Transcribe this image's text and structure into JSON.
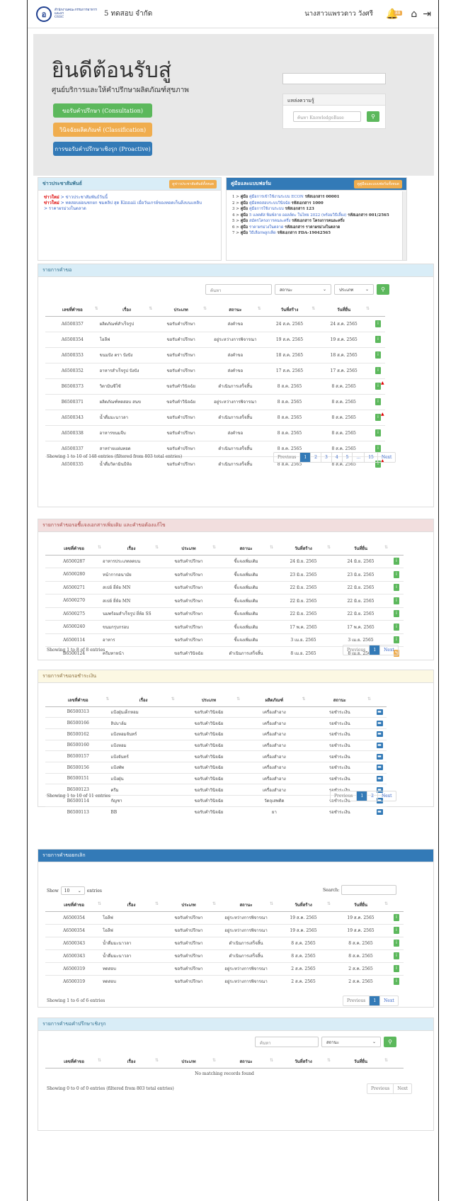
{
  "header": {
    "logo_text": "สำนักงานคณะกรรมการอาหารและยา",
    "logo_sub": "OSSC",
    "company": "5 ทดสอบ จำกัด",
    "username": "นางสาวแพรวดาว วังศรี",
    "notif_badge": "88"
  },
  "hero": {
    "title": "ยินดีต้อนรับสู่",
    "subtitle": "ศูนย์บริการและให้คำปรึกษาผลิตภัณฑ์สุขภาพ",
    "btn_consult": "ขอรับคำปรึกษา (Consultation)",
    "btn_classify": "วินิจฉัยผลิตภัณฑ์ (Classification)",
    "btn_proactive": "การขอรับคำปรึกษาเชิงรุก (Proactive)",
    "knowledge_title": "แหล่งความรู้",
    "knowledge_placeholder": "ค้นหา KnowledgeBase"
  },
  "news": {
    "title": "ข่าวประชาสัมพันธ์",
    "btn": "ดูข่าวประชาสัมพันธ์ทั้งหมด",
    "items": [
      {
        "tag": "ข่าวใหม่",
        "text": "> ข่าวประชาสัมพันธ์วันนี้"
      },
      {
        "tag": "ข่าวใหม่",
        "text": "> ทดสอบผ่อนชกยก ชมคลิป สุด Kinnaii เมื่อวันเกรย์ของทอดเก็นลีงบนแหลิบ"
      },
      {
        "tag": "",
        "text": "> ราคาผรม่วงในตลาด"
      }
    ]
  },
  "manual": {
    "title": "คู่มือและแบบฟอร์ม",
    "btn": "ดูคู่มือและแบบฟอร์มทั้งหมด",
    "items": [
      {
        "n": "1 >",
        "k": "คู่มือ",
        "t": "คู่มือการเข้าใช้งานระบบ ECON",
        "r": "รหัสเอกสาร 00001"
      },
      {
        "n": "2 >",
        "k": "คู่มือ",
        "t": "คู่มือทดสอบระบบวินิจฉัย",
        "r": "รหัสเอกสาร 1000"
      },
      {
        "n": "3 >",
        "k": "คู่มือ",
        "t": "คู่มือการใช้งานระบบ",
        "r": "รหัสเอกสาร 123"
      },
      {
        "n": "4 >",
        "k": "คู่มือ",
        "t": "5 แลคตัส พิมพ์ลาย ออลล์ตะ ในไทย 2022 (พร้อมวิธีเลี้ยง)",
        "r": "รหัสเอกสาร 001/2565"
      },
      {
        "n": "5 >",
        "k": "คู่มือ",
        "t": "สมัครโครงการคนละครึ่ง",
        "r": "รหัสเอกสาร โครงการคนละครึ่ง"
      },
      {
        "n": "6 >",
        "k": "คู่มือ",
        "t": "ราคาผรม่วงในตลาด",
        "r": "รหัสเอกสาร ราคาผรม่วงในตลาด"
      },
      {
        "n": "7 >",
        "k": "คู่มือ",
        "t": "วิธีเลือกพลูกเห็ด",
        "r": "รหัสเอกสาร FDA-19042565"
      }
    ]
  },
  "requests": {
    "title": "รายการคำขอ",
    "search_placeholder": "ค้นหา",
    "status_label": "สถานะ",
    "type_label": "ประเภท",
    "columns": [
      "เลขที่คำขอ",
      "เรื่อง",
      "ประเภท",
      "สถานะ",
      "วันที่สร้าง",
      "วันที่ยื่น"
    ],
    "rows": [
      [
        "A6500357",
        "ผลิตภัณฑ์สำเร็จรูป",
        "ขอรับคำปรึกษา",
        "ส่งคำขอ",
        "24 ส.ค. 2565",
        "24 ส.ค. 2565"
      ],
      [
        "A6500354",
        "โอลีฟ",
        "ขอรับคำปรึกษา",
        "อยู่ระหว่างการพิจารณา",
        "19 ส.ค. 2565",
        "19 ส.ค. 2565"
      ],
      [
        "A6500353",
        "ขนมปัง ตรา ปังปัง",
        "ขอรับคำปรึกษา",
        "ส่งคำขอ",
        "18 ส.ค. 2565",
        "18 ส.ค. 2565"
      ],
      [
        "A6500352",
        "อาหารสำเร็จรูป ปังปัง",
        "ขอรับคำปรึกษา",
        "ส่งคำขอ",
        "17 ส.ค. 2565",
        "17 ส.ค. 2565"
      ],
      [
        "B6500373",
        "วิตามินซีโซ้",
        "ขอรับคำวินิจฉัย",
        "ดำเนินการเสร็จสิ้น",
        "8 ส.ค. 2565",
        "8 ส.ค. 2565"
      ],
      [
        "B6500371",
        "ผลิตภัณฑ์ทดสอบ สนข",
        "ขอรับคำวินิจฉัย",
        "อยู่ระหว่างการพิจารณา",
        "8 ส.ค. 2565",
        "8 ส.ค. 2565"
      ],
      [
        "A6500343",
        "น้ำดื่มมะนาวลา",
        "ขอรับคำปรึกษา",
        "ดำเนินการเสร็จสิ้น",
        "8 ส.ค. 2565",
        "8 ส.ค. 2565"
      ],
      [
        "A6500338",
        "อาหารขนมจีบ",
        "ขอรับคำปรึกษา",
        "ส่งคำขอ",
        "8 ส.ค. 2565",
        "8 ส.ค. 2565"
      ],
      [
        "A6500337",
        "สาหร่ายแผ่นทอด",
        "ขอรับคำปรึกษา",
        "ดำเนินการเสร็จสิ้น",
        "8 ส.ค. 2565",
        "8 ส.ค. 2565"
      ],
      [
        "A6500335",
        "น้ำดื่มวิตามินบีห้อ",
        "ขอรับคำปรึกษา",
        "ดำเนินการเสร็จสิ้น",
        "8 ส.ค. 2565",
        "8 ส.ค. 2565"
      ]
    ],
    "info": "Showing 1 to 10 of 148 entries (filtered from 803 total entries)",
    "pages": [
      "Previous",
      "1",
      "2",
      "3",
      "4",
      "5",
      "...",
      "15",
      "Next"
    ]
  },
  "pending_docs": {
    "title": "รายการคำขอรอชี้แจงเอกสารเพิ่มเติม และคำขอต้องแก้ไข",
    "columns": [
      "เลขที่คำขอ",
      "เรื่อง",
      "ประเภท",
      "สถานะ",
      "วันที่สร้าง",
      "วันที่ยื่น"
    ],
    "rows": [
      [
        "A6500287",
        "อาหารประเภทลดบน",
        "ขอรับคำปรึกษา",
        "ชี้แจงเพิ่มเติม",
        "24 มิ.ย. 2565",
        "24 มิ.ย. 2565"
      ],
      [
        "A6500280",
        "หน้ากากอนามัย",
        "ขอรับคำปรึกษา",
        "ชี้แจงเพิ่มเติม",
        "23 มิ.ย. 2565",
        "23 มิ.ย. 2565"
      ],
      [
        "A6500271",
        "สเปย์ ยี่ห้อ MN",
        "ขอรับคำปรึกษา",
        "ชี้แจงเพิ่มเติม",
        "22 มิ.ย. 2565",
        "22 มิ.ย. 2565"
      ],
      [
        "A6500270",
        "สเปย์ ยี่ห้อ MN",
        "ขอรับคำปรึกษา",
        "ชี้แจงเพิ่มเติม",
        "22 มิ.ย. 2565",
        "22 มิ.ย. 2565"
      ],
      [
        "A6500275",
        "นมพร้อมสำเร็จรูป ยี่ห้อ SS",
        "ขอรับคำปรึกษา",
        "ชี้แจงเพิ่มเติม",
        "22 มิ.ย. 2565",
        "22 มิ.ย. 2565"
      ],
      [
        "A6500240",
        "ขนมกรุบกรอบ",
        "ขอรับคำปรึกษา",
        "ชี้แจงเพิ่มเติม",
        "17 พ.ค. 2565",
        "17 พ.ค. 2565"
      ],
      [
        "A6500114",
        "อาหาร",
        "ขอรับคำปรึกษา",
        "ชี้แจงเพิ่มเติม",
        "3 เม.ย. 2565",
        "3 เม.ย. 2565"
      ],
      [
        "B6500124",
        "ครีมทาหน้า",
        "ขอรับคำวินิจฉัย",
        "ดำเนินการเสร็จสิ้น",
        "8 เม.ย. 2565",
        "8 เม.ย. 2565"
      ]
    ],
    "info": "Showing 1 to 8 of 8 entries",
    "pages": [
      "Previous",
      "1",
      "Next"
    ]
  },
  "payment": {
    "title": "รายการคำขอรอชำระเงิน",
    "columns": [
      "เลขที่คำขอ",
      "เรื่อง",
      "ประเภท",
      "ผลิตภัณฑ์",
      "สถานะ"
    ],
    "rows": [
      [
        "B6500313",
        "แป้งฝุ่นเด็กหอม",
        "ขอรับคำวินิจฉัย",
        "เครื่องสำอาง",
        "รอชำระเงิน"
      ],
      [
        "B6500166",
        "ลิปบาล์ม",
        "ขอรับคำวินิจฉัย",
        "เครื่องสำอาง",
        "รอชำระเงิน"
      ],
      [
        "B6500162",
        "แป้งหอมจันทร์",
        "ขอรับคำวินิจฉัย",
        "เครื่องสำอาง",
        "รอชำระเงิน"
      ],
      [
        "B6500160",
        "แป้งหอม",
        "ขอรับคำวินิจฉัย",
        "เครื่องสำอาง",
        "รอชำระเงิน"
      ],
      [
        "B6500157",
        "แป้งจันทร์",
        "ขอรับคำวินิจฉัย",
        "เครื่องสำอาง",
        "รอชำระเงิน"
      ],
      [
        "B6500156",
        "แป้งพัพ",
        "ขอรับคำวินิจฉัย",
        "เครื่องสำอาง",
        "รอชำระเงิน"
      ],
      [
        "B6500151",
        "แป้งฝุ่น",
        "ขอรับคำวินิจฉัย",
        "เครื่องสำอาง",
        "รอชำระเงิน"
      ],
      [
        "B6500123",
        "ครีม",
        "ขอรับคำวินิจฉัย",
        "เครื่องสำอาง",
        "รอชำระเงิน"
      ],
      [
        "B6500114",
        "กัญชา",
        "ขอรับคำวินิจฉัย",
        "วัตถุเสพติด",
        "รอชำระเงิน"
      ],
      [
        "B6500113",
        "BB",
        "ขอรับคำวินิจฉัย",
        "ยา",
        "รอชำระเงิน"
      ]
    ],
    "info": "Showing 1 to 10 of 11 entries",
    "pages": [
      "Previous",
      "1",
      "2",
      "Next"
    ]
  },
  "cancelled": {
    "title": "รายการคำขอยกเลิก",
    "show_label": "Show",
    "show_value": "10",
    "entries_label": "entries",
    "search_label": "Search:",
    "columns": [
      "เลขที่คำขอ",
      "เรื่อง",
      "ประเภท",
      "สถานะ",
      "วันที่สร้าง",
      "วันที่ยื่น"
    ],
    "rows": [
      [
        "A6500354",
        "โอลีฟ",
        "ขอรับคำปรึกษา",
        "อยู่ระหว่างการพิจารณา",
        "19 ส.ค. 2565",
        "19 ส.ค. 2565"
      ],
      [
        "A6500354",
        "โอลีฟ",
        "ขอรับคำปรึกษา",
        "อยู่ระหว่างการพิจารณา",
        "19 ส.ค. 2565",
        "19 ส.ค. 2565"
      ],
      [
        "A6500343",
        "น้ำดื่มมะนาวลา",
        "ขอรับคำปรึกษา",
        "ดำเนินการเสร็จสิ้น",
        "8 ส.ค. 2565",
        "8 ส.ค. 2565"
      ],
      [
        "A6500343",
        "น้ำดื่มมะนาวลา",
        "ขอรับคำปรึกษา",
        "ดำเนินการเสร็จสิ้น",
        "8 ส.ค. 2565",
        "8 ส.ค. 2565"
      ],
      [
        "A6500319",
        "ทดสอบ",
        "ขอรับคำปรึกษา",
        "อยู่ระหว่างการพิจารณา",
        "2 ส.ค. 2565",
        "2 ส.ค. 2565"
      ],
      [
        "A6500319",
        "ทดสอบ",
        "ขอรับคำปรึกษา",
        "อยู่ระหว่างการพิจารณา",
        "2 ส.ค. 2565",
        "2 ส.ค. 2565"
      ]
    ],
    "info": "Showing 1 to 6 of 6 entries",
    "pages": [
      "Previous",
      "1",
      "Next"
    ]
  },
  "proactive": {
    "title": "รายการคำขอคำปรึกษาเชิงรุก",
    "search_placeholder": "ค้นหา",
    "status_label": "สถานะ",
    "columns": [
      "เลขที่คำขอ",
      "เรื่อง",
      "ประเภท",
      "สถานะ",
      "วันที่สร้าง",
      "วันที่ยื่น"
    ],
    "empty": "No matching records found",
    "info": "Showing 0 to 0 of 0 entries (filtered from 803 total entries)",
    "pages": [
      "Previous",
      "Next"
    ]
  },
  "colors": {
    "green": "#5cb85c",
    "orange": "#f0ad4e",
    "blue": "#337ab7",
    "light_blue_head": "#d9edf7",
    "pink_head": "#f2dede",
    "yellow_head": "#fcf8e3"
  }
}
